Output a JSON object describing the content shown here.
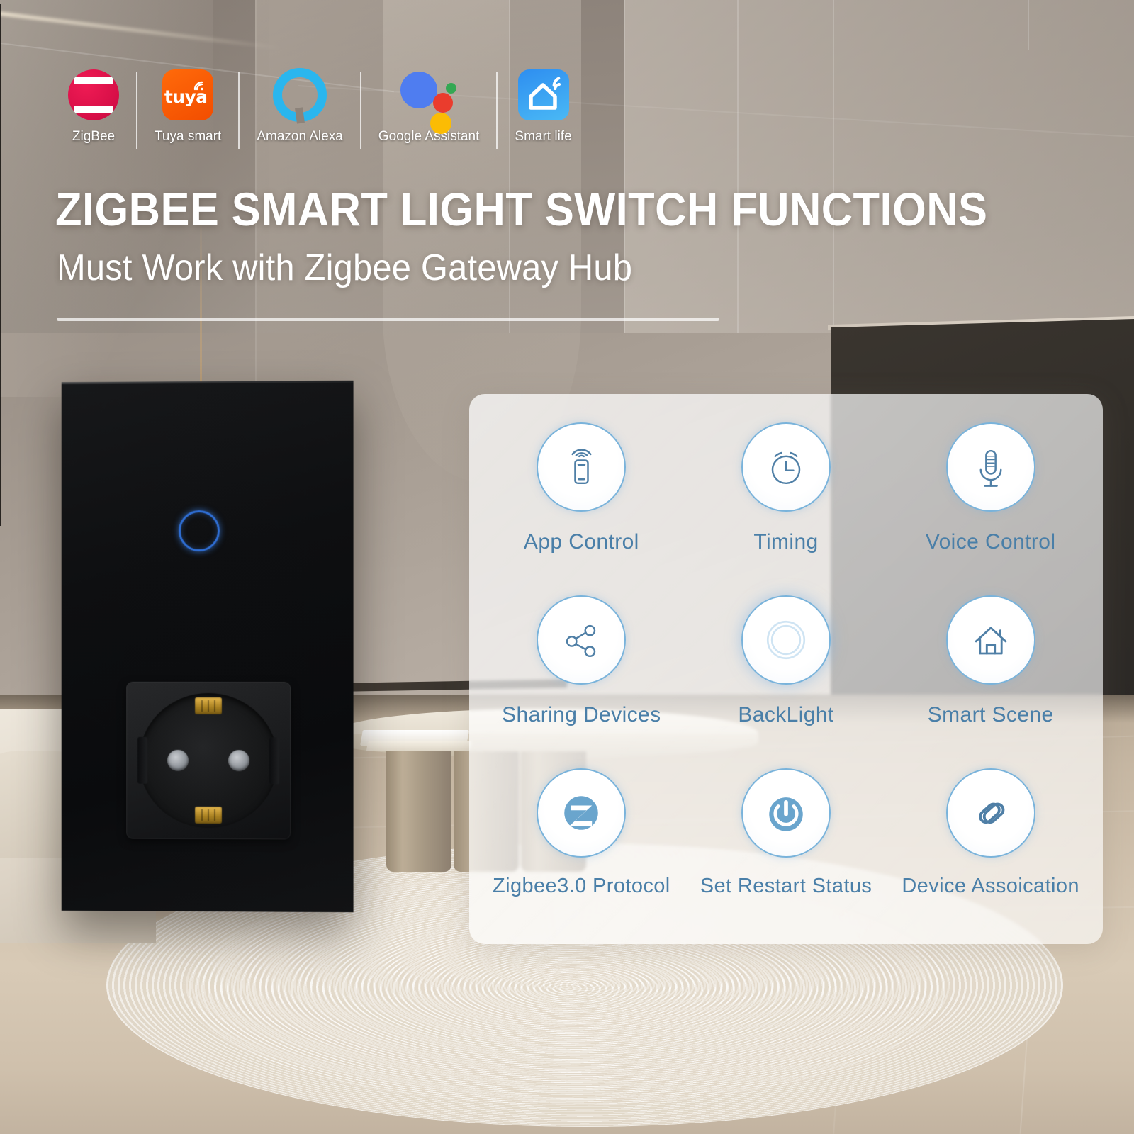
{
  "header": {
    "title": "ZIGBEE SMART LIGHT SWITCH FUNCTIONS",
    "subtitle": "Must Work with Zigbee Gateway Hub"
  },
  "brands": [
    {
      "label": "ZigBee",
      "icon": "zigbee-logo-icon",
      "color": "#e0114b"
    },
    {
      "label": "Tuya smart",
      "icon": "tuya-logo-icon",
      "color": "#ff5a00"
    },
    {
      "label": "Amazon Alexa",
      "icon": "amazon-alexa-logo-icon",
      "color": "#2ab6ee"
    },
    {
      "label": "Google Assistant",
      "icon": "google-assistant-logo-icon",
      "color": "#4285f4"
    },
    {
      "label": "Smart life",
      "icon": "smart-life-logo-icon",
      "color": "#3a9bf2"
    }
  ],
  "brand_word": {
    "tuya": "tuya"
  },
  "features": [
    {
      "label": "App Control",
      "icon": "app-control-icon"
    },
    {
      "label": "Timing",
      "icon": "alarm-clock-icon"
    },
    {
      "label": "Voice Control",
      "icon": "microphone-icon"
    },
    {
      "label": "Sharing Devices",
      "icon": "share-nodes-icon"
    },
    {
      "label": "BackLight",
      "icon": "backlight-ring-icon"
    },
    {
      "label": "Smart Scene",
      "icon": "home-house-icon"
    },
    {
      "label": "Zigbee3.0 Protocol",
      "icon": "zigbee-badge-icon"
    },
    {
      "label": "Set Restart Status",
      "icon": "power-button-icon"
    },
    {
      "label": "Device Assoication",
      "icon": "link-chain-icon"
    }
  ],
  "device": {
    "name": "zigbee-smart-switch-with-socket",
    "touch_button": "touch-indicator-ring",
    "socket_type": "schuko-eu-socket"
  },
  "colors": {
    "accent_blue": "#4a7fa8",
    "icon_outline": "#79b3db",
    "headline_text": "#ffffff",
    "device_body": "#0e0f11",
    "touch_ring": "#2f6fd6"
  }
}
